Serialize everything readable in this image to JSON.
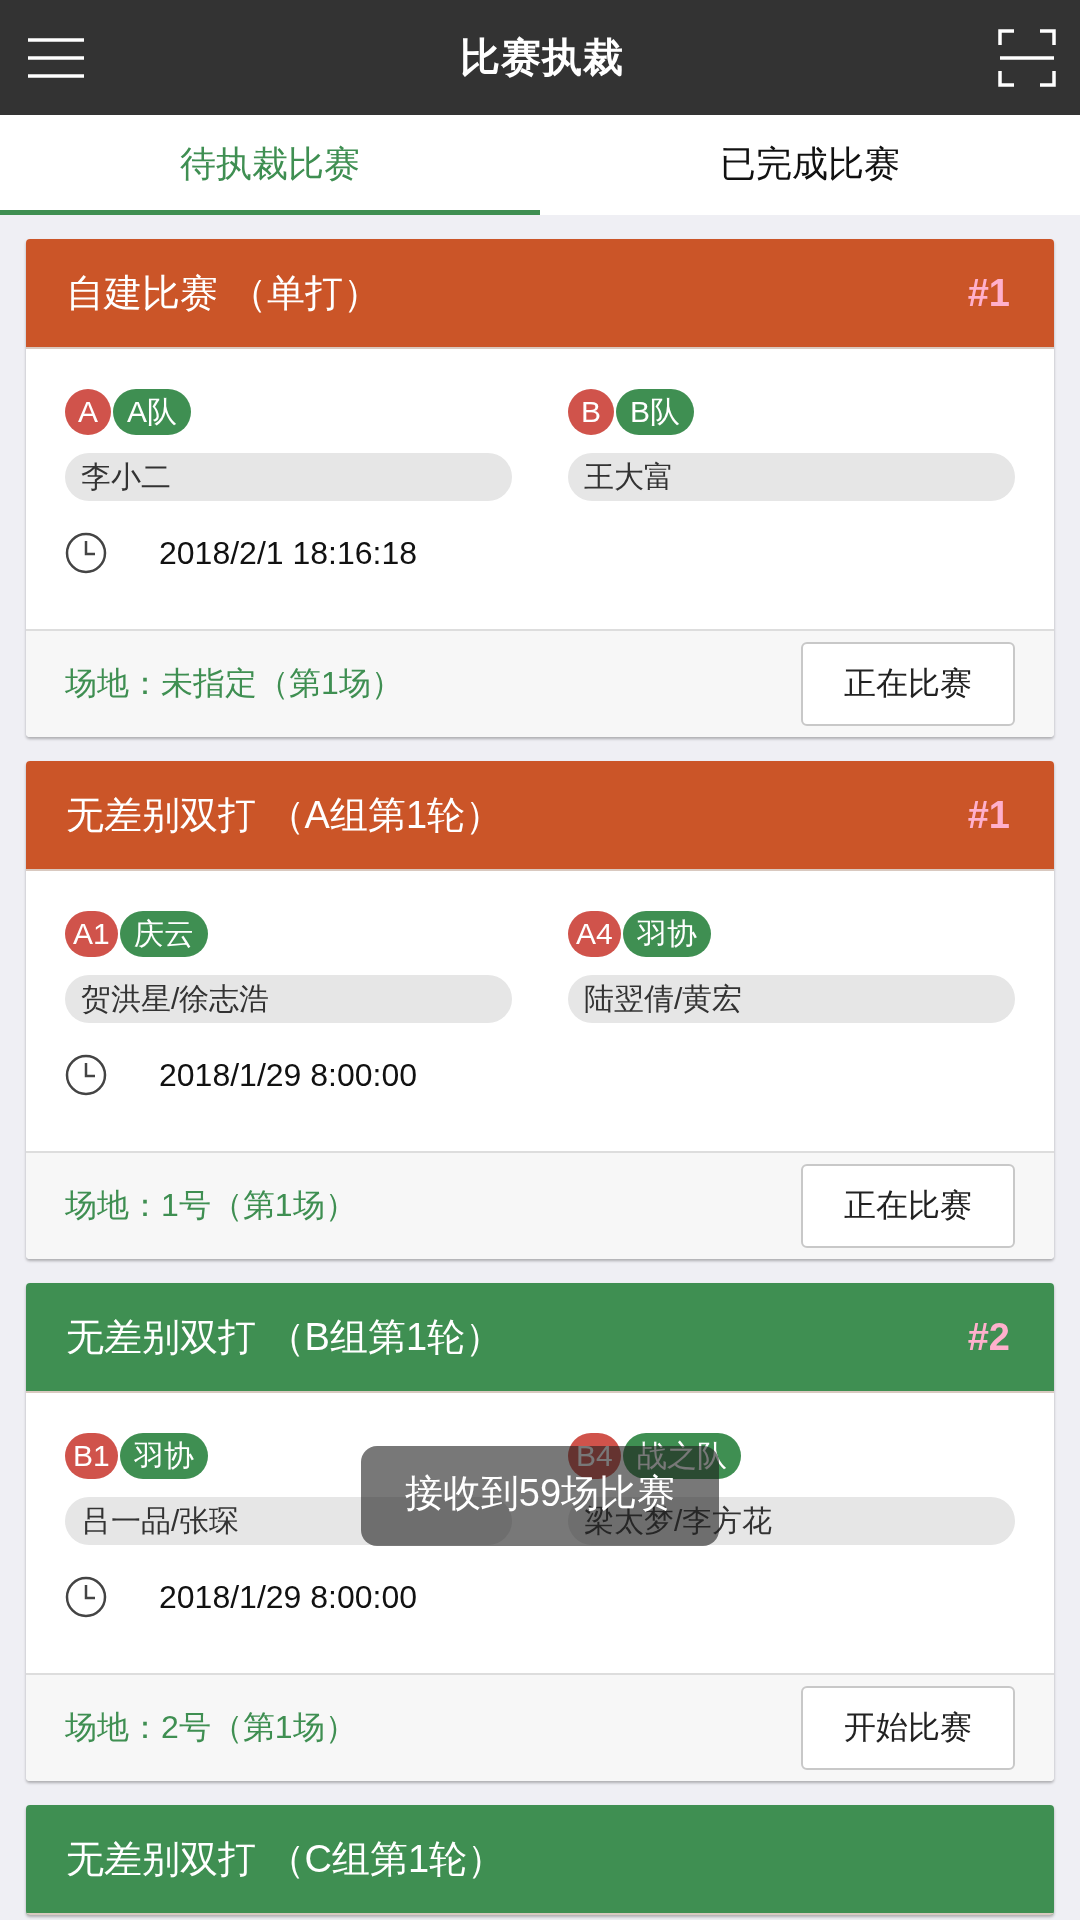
{
  "app_bar": {
    "title": "比赛执裁"
  },
  "tabs": [
    {
      "label": "待执裁比赛",
      "selected": true
    },
    {
      "label": "已完成比赛",
      "selected": false
    }
  ],
  "matches": [
    {
      "title": "自建比赛 （单打）",
      "number": "#1",
      "color": "#cb5528",
      "players": [
        {
          "seed": "A",
          "team": "A队",
          "names": "李小二"
        },
        {
          "seed": "B",
          "team": "B队",
          "names": "王大富"
        }
      ],
      "time": "2018/2/1 18:16:18",
      "venue": "场地：未指定（第1场）",
      "action": "正在比赛"
    },
    {
      "title": "无差别双打 （A组第1轮）",
      "number": "#1",
      "color": "#cb5528",
      "players": [
        {
          "seed": "A1",
          "team": "庆云",
          "names": "贺洪星/徐志浩"
        },
        {
          "seed": "A4",
          "team": "羽协",
          "names": "陆翌倩/黄宏"
        }
      ],
      "time": "2018/1/29 8:00:00",
      "venue": "场地：1号（第1场）",
      "action": "正在比赛"
    },
    {
      "title": "无差别双打 （B组第1轮）",
      "number": "#2",
      "color": "#3f8f52",
      "players": [
        {
          "seed": "B1",
          "team": "羽协",
          "names": "吕一品/张琛"
        },
        {
          "seed": "B4",
          "team": "战之队",
          "names": "梁太梦/李方花"
        }
      ],
      "time": "2018/1/29 8:00:00",
      "venue": "场地：2号（第1场）",
      "action": "开始比赛"
    },
    {
      "title": "无差别双打 （C组第1轮）",
      "color": "#3f8f52"
    }
  ],
  "toast": "接收到59场比赛"
}
